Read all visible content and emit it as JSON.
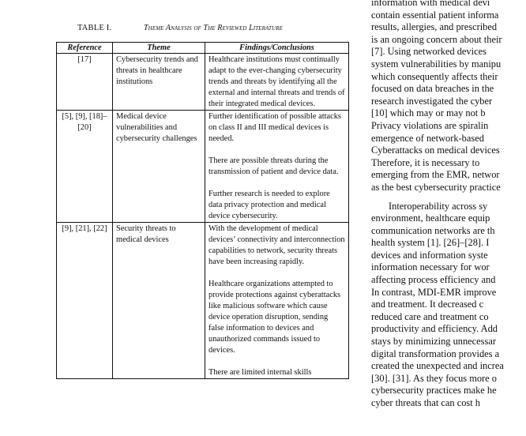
{
  "table": {
    "label": "TABLE I.",
    "title": "Theme Analysis of The Reviewed Literature",
    "headers": [
      "Reference",
      "Theme",
      "Findings/Conclusions"
    ],
    "rows": [
      {
        "reference": "[17]",
        "theme": "Cybersecurity trends and threats in healthcare institutions",
        "findings": [
          "Healthcare institutions must continually adapt to the ever-changing cybersecurity trends and threats by identifying all the external and internal threats and trends of their integrated medical devices."
        ]
      },
      {
        "reference": "[5], [9], [18]–[20]",
        "theme": "Medical device vulnerabilities and cybersecurity challenges",
        "findings": [
          "Further identification of possible attacks on class II and III medical devices is needed.",
          "There are possible threats during the transmission of patient and device data.",
          "Further research is needed to explore data privacy protection and medical device cybersecurity."
        ]
      },
      {
        "reference": "[9], [21], [22]",
        "theme": "Security threats to medical devices",
        "findings": [
          "With the development of medical devices’ connectivity and interconnection capabilities to network, security threats have been increasing rapidly.",
          "Healthcare organizations attempted to provide protections against cyberattacks like malicious software which cause device operation disruption, sending false information to devices and unauthorized commands issued to devices.",
          "There are limited internal skills"
        ]
      }
    ]
  },
  "body_text": {
    "lines": [
      "information with medical devi",
      "contain essential patient informa",
      "results, allergies, and prescribed",
      "is an ongoing concern about their",
      "[7]. Using networked devices",
      "system vulnerabilities by manipu",
      "which consequently affects their",
      "focused on data breaches in the",
      "research investigated the cyber",
      "[10] which may or may not b",
      "Privacy violations are spiralin",
      "emergence of network-based",
      "Cyberattacks on medical devices",
      "Therefore, it is necessary to",
      "emerging from the EMR, networ",
      "as the best cybersecurity practice"
    ],
    "lines_p2": [
      "Interoperability across sy",
      "environment, healthcare equip",
      "communication networks are th",
      "health system [1]. [26]–[28]. I",
      "devices and information syste",
      "information necessary for wor",
      "affecting process efficiency and",
      "In contrast, MDI-EMR improve",
      "and treatment. It decreased c",
      "reduced care and treatment co",
      "productivity and efficiency. Add",
      "stays by minimizing unnecessar",
      "digital transformation provides a",
      "created the unexpected and increa",
      "[30]. [31]. As they focus more o",
      "cybersecurity practices make he",
      "cyber threats that can cost h"
    ]
  }
}
